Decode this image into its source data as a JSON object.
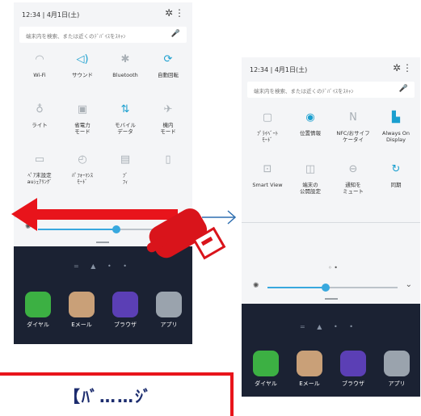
{
  "left_panel": {
    "time": "12:34",
    "date": "4月1日(土)",
    "search_placeholder": "端末内を検索、または近くのﾃﾞﾊﾞｲｽをｽｷｬﾝ",
    "tiles": [
      {
        "label": "Wi-Fi",
        "icon": "wifi-icon",
        "active": false
      },
      {
        "label": "サウンド",
        "icon": "sound-icon",
        "active": true
      },
      {
        "label": "Bluetooth",
        "icon": "bluetooth-icon",
        "active": false
      },
      {
        "label": "自動回転",
        "icon": "rotate-icon",
        "active": true
      },
      {
        "label": "ライト",
        "icon": "flashlight-icon",
        "active": false
      },
      {
        "label": "省電力\nモード",
        "icon": "power-saving-icon",
        "active": false
      },
      {
        "label": "モバイル\nデータ",
        "icon": "mobile-data-icon",
        "active": true
      },
      {
        "label": "機内\nモード",
        "icon": "airplane-icon",
        "active": false
      },
      {
        "label": "ﾍﾟｱ末設定\nauｼｪｱﾘﾝｸﾞ",
        "icon": "device-icon",
        "active": false
      },
      {
        "label": "ﾊﾟﾌｫｰﾏﾝｽ\nﾓｰﾄﾞ",
        "icon": "performance-icon",
        "active": false
      },
      {
        "label": "ﾌﾞ\nﾌｨ",
        "icon": "document-icon",
        "active": false
      },
      {
        "label": "",
        "icon": "page-icon",
        "active": false
      }
    ],
    "brightness": 0.55,
    "apps": [
      {
        "label": "ダイヤル",
        "color": "#3cb043"
      },
      {
        "label": "Eメール",
        "color": "#c9a078"
      },
      {
        "label": "ブラウザ",
        "color": "#5b3fb5"
      },
      {
        "label": "アプリ",
        "color": "#9aa3ad"
      }
    ]
  },
  "right_panel": {
    "time": "12:34",
    "date": "4月1日(土)",
    "search_placeholder": "端末内を検索、または近くのﾃﾞﾊﾞｲｽをｽｷｬﾝ",
    "tiles": [
      {
        "label": "ﾌﾟﾗｲﾍﾞｰﾄ\nﾓｰﾄﾞ",
        "icon": "private-mode-icon",
        "active": false
      },
      {
        "label": "位置情報",
        "icon": "location-icon",
        "active": true
      },
      {
        "label": "NFC/おサイフ\nケータイ",
        "icon": "nfc-icon",
        "active": false
      },
      {
        "label": "Always On\nDisplay",
        "icon": "always-on-display-icon",
        "active": true
      },
      {
        "label": "Smart View",
        "icon": "smart-view-icon",
        "active": false
      },
      {
        "label": "端末の\n公開設定",
        "icon": "visibility-icon",
        "active": false
      },
      {
        "label": "通知を\nミュート",
        "icon": "mute-icon",
        "active": false
      },
      {
        "label": "同期",
        "icon": "sync-icon",
        "active": true
      }
    ],
    "brightness": 0.45,
    "apps": [
      {
        "label": "ダイヤル",
        "color": "#3cb043"
      },
      {
        "label": "Eメール",
        "color": "#c9a078"
      },
      {
        "label": "ブラウザ",
        "color": "#5b3fb5"
      },
      {
        "label": "アプリ",
        "color": "#9aa3ad"
      }
    ]
  },
  "banner_text": "【ﾊﾞ……ｼﾞ",
  "colors": {
    "accent": "#38a8de",
    "swipe_arrow": "#e8141b",
    "hand": "#d9141b",
    "arrow_connector": "#2f6fb0"
  }
}
